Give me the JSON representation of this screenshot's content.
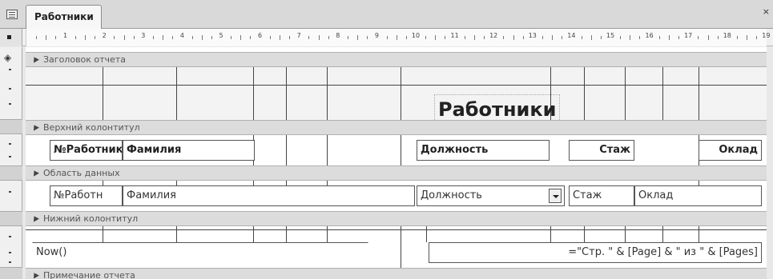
{
  "tab": {
    "title": "Работники",
    "close": "×"
  },
  "ruler": {
    "numbers": [
      "1",
      "2",
      "3",
      "4",
      "5",
      "6",
      "7",
      "8",
      "9",
      "10",
      "11",
      "12",
      "13",
      "14",
      "15",
      "16",
      "17",
      "18",
      "19"
    ]
  },
  "bands": {
    "report_header": "Заголовок отчета",
    "page_header": "Верхний колонтитул",
    "detail": "Область данных",
    "page_footer": "Нижний колонтитул",
    "report_footer": "Примечание отчета"
  },
  "report_header": {
    "title": "Работники"
  },
  "page_header": {
    "id_label": "№Работника",
    "surname_label": "Фамилия",
    "position_label": "Должность",
    "tenure_label": "Стаж",
    "salary_label": "Оклад"
  },
  "detail": {
    "id_field": "№Работн",
    "surname_field": "Фамилия",
    "position_field": "Должность",
    "tenure_field": "Стаж",
    "salary_field": "Оклад"
  },
  "page_footer": {
    "date_expr": "Now()",
    "page_expr": "=\"Стр. \" & [Page] & \" из \" & [Pages]"
  }
}
